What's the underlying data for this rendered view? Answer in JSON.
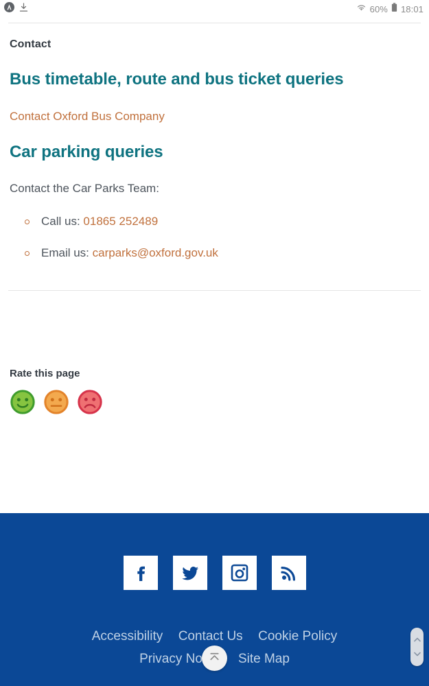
{
  "status_bar": {
    "app_icon": "app-badge-icon",
    "download_icon": "download-icon",
    "wifi_icon": "wifi-icon",
    "battery_percent": "60%",
    "battery_icon": "battery-icon",
    "time": "18:01"
  },
  "page": {
    "section_label": "Contact",
    "heading_bus": "Bus timetable, route and bus ticket queries",
    "link_bus": "Contact Oxford Bus Company",
    "heading_parking": "Car parking queries",
    "paragraph_parking": "Contact the Car Parks Team:",
    "bullets": [
      {
        "label": "Call us: ",
        "value": "01865 252489"
      },
      {
        "label": "Email us: ",
        "value": "carparks@oxford.gov.uk"
      }
    ]
  },
  "rate": {
    "title": "Rate this page",
    "options": [
      {
        "name": "happy-face-icon",
        "color": "#4aa832",
        "fill": "#86c440"
      },
      {
        "name": "neutral-face-icon",
        "color": "#e8872a",
        "fill": "#f3a94e"
      },
      {
        "name": "sad-face-icon",
        "color": "#d6334a",
        "fill": "#ef7072"
      }
    ]
  },
  "footer": {
    "background": "#0b4896",
    "link_color": "#c0d2e6",
    "social": [
      {
        "name": "facebook-icon",
        "label": "Facebook"
      },
      {
        "name": "twitter-icon",
        "label": "Twitter"
      },
      {
        "name": "instagram-icon",
        "label": "Instagram"
      },
      {
        "name": "rss-icon",
        "label": "RSS"
      }
    ],
    "links_row1": [
      "Accessibility",
      "Contact Us",
      "Cookie Policy"
    ],
    "links_row2": [
      "Privacy Notice",
      "Site Map"
    ]
  },
  "overlays": {
    "scroll_to_top_icon": "scroll-to-top-icon",
    "scrollbar_icon": "scrollbar-thumb"
  },
  "colors": {
    "heading_teal": "#0e7380",
    "link_orange": "#c0703c",
    "body_grey": "#4d545c",
    "footer_blue": "#0b4896"
  }
}
